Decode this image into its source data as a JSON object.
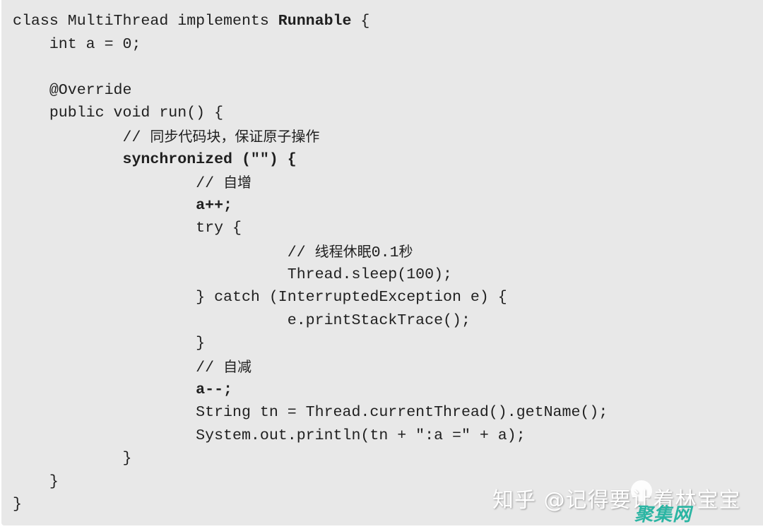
{
  "code_block": {
    "language": "java",
    "lines": [
      {
        "indent": 0,
        "tokens": [
          {
            "text": "class MultiThread implements ",
            "bold": false
          },
          {
            "text": "Runnable",
            "bold": true
          },
          {
            "text": " {",
            "bold": false
          }
        ]
      },
      {
        "indent": 4,
        "tokens": [
          {
            "text": "int a = 0;",
            "bold": false
          }
        ]
      },
      {
        "indent": 0,
        "tokens": []
      },
      {
        "indent": 4,
        "tokens": [
          {
            "text": "@Override",
            "bold": false
          }
        ]
      },
      {
        "indent": 4,
        "tokens": [
          {
            "text": "public void run() {",
            "bold": false
          }
        ]
      },
      {
        "indent": 12,
        "tokens": [
          {
            "text": "// ",
            "bold": false
          },
          {
            "text": "同步代码块，保证原子操作",
            "bold": false,
            "cjk": true
          }
        ]
      },
      {
        "indent": 12,
        "tokens": [
          {
            "text": "synchronized (\"\") {",
            "bold": true
          }
        ]
      },
      {
        "indent": 20,
        "tokens": [
          {
            "text": "// ",
            "bold": false
          },
          {
            "text": "自增",
            "bold": false,
            "cjk": true
          }
        ]
      },
      {
        "indent": 20,
        "tokens": [
          {
            "text": "a++;",
            "bold": true
          }
        ]
      },
      {
        "indent": 20,
        "tokens": [
          {
            "text": "try {",
            "bold": false
          }
        ]
      },
      {
        "indent": 30,
        "tokens": [
          {
            "text": "// ",
            "bold": false
          },
          {
            "text": "线程休眠",
            "bold": false,
            "cjk": true
          },
          {
            "text": "0.1",
            "bold": false
          },
          {
            "text": "秒",
            "bold": false,
            "cjk": true
          }
        ]
      },
      {
        "indent": 30,
        "tokens": [
          {
            "text": "Thread.sleep(100);",
            "bold": false
          }
        ]
      },
      {
        "indent": 20,
        "tokens": [
          {
            "text": "} catch (InterruptedException e) {",
            "bold": false
          }
        ]
      },
      {
        "indent": 30,
        "tokens": [
          {
            "text": "e.printStackTrace();",
            "bold": false
          }
        ]
      },
      {
        "indent": 20,
        "tokens": [
          {
            "text": "}",
            "bold": false
          }
        ]
      },
      {
        "indent": 20,
        "tokens": [
          {
            "text": "// ",
            "bold": false
          },
          {
            "text": "自减",
            "bold": false,
            "cjk": true
          }
        ]
      },
      {
        "indent": 20,
        "tokens": [
          {
            "text": "a--;",
            "bold": true
          }
        ]
      },
      {
        "indent": 20,
        "tokens": [
          {
            "text": "String tn = Thread.currentThread().getName();",
            "bold": false
          }
        ]
      },
      {
        "indent": 20,
        "tokens": [
          {
            "text": "System.out.println(tn + \":a =\" + a);",
            "bold": false
          }
        ]
      },
      {
        "indent": 12,
        "tokens": [
          {
            "text": "}",
            "bold": false
          }
        ]
      },
      {
        "indent": 4,
        "tokens": [
          {
            "text": "}",
            "bold": false
          }
        ]
      },
      {
        "indent": 0,
        "tokens": [
          {
            "text": "}",
            "bold": false
          }
        ]
      }
    ]
  },
  "watermark": {
    "text": "知乎 @记得要让着林宝宝",
    "overlay_text": "聚集网",
    "overlay_color": "#2bb5a3"
  },
  "colors": {
    "code_background": "#e8e8e8",
    "code_text": "#1f1f1f",
    "page_background": "#ffffff"
  }
}
